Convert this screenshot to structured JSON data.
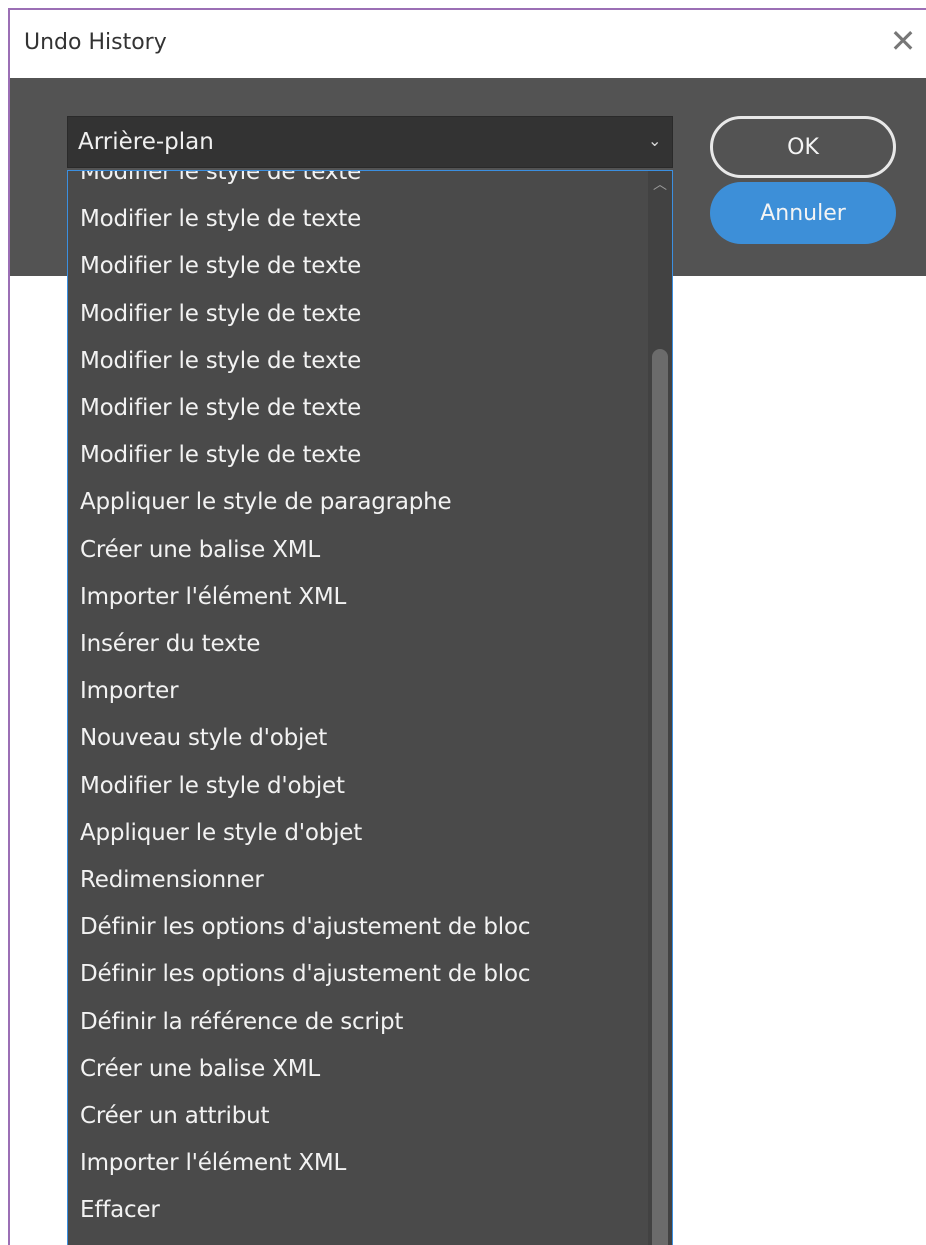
{
  "window": {
    "title": "Undo History",
    "close_glyph": "✕"
  },
  "dropdown": {
    "value": "Arrière-plan",
    "chevron": "⌄"
  },
  "buttons": {
    "ok": "OK",
    "cancel": "Annuler"
  },
  "list": {
    "items": [
      "Modifier le style de texte",
      "Modifier le style de texte",
      "Modifier le style de texte",
      "Modifier le style de texte",
      "Modifier le style de texte",
      "Modifier le style de texte",
      "Modifier le style de texte",
      "Appliquer le style de paragraphe",
      "Créer une balise XML",
      "Importer l'élément XML",
      "Insérer du texte",
      "Importer",
      "Nouveau style d'objet",
      "Modifier le style d'objet",
      "Appliquer le style d'objet",
      "Redimensionner",
      "Définir les options d'ajustement de bloc",
      "Définir les options d'ajustement de bloc",
      "Définir la référence de script",
      "Créer une balise XML",
      "Créer un attribut",
      "Importer l'élément XML",
      "Effacer"
    ],
    "scroll_up_glyph": "︿"
  },
  "colors": {
    "panel": "#535353",
    "list_bg": "#4a4a4a",
    "accent": "#3d8fd8",
    "window_border": "#9b6fb5"
  }
}
